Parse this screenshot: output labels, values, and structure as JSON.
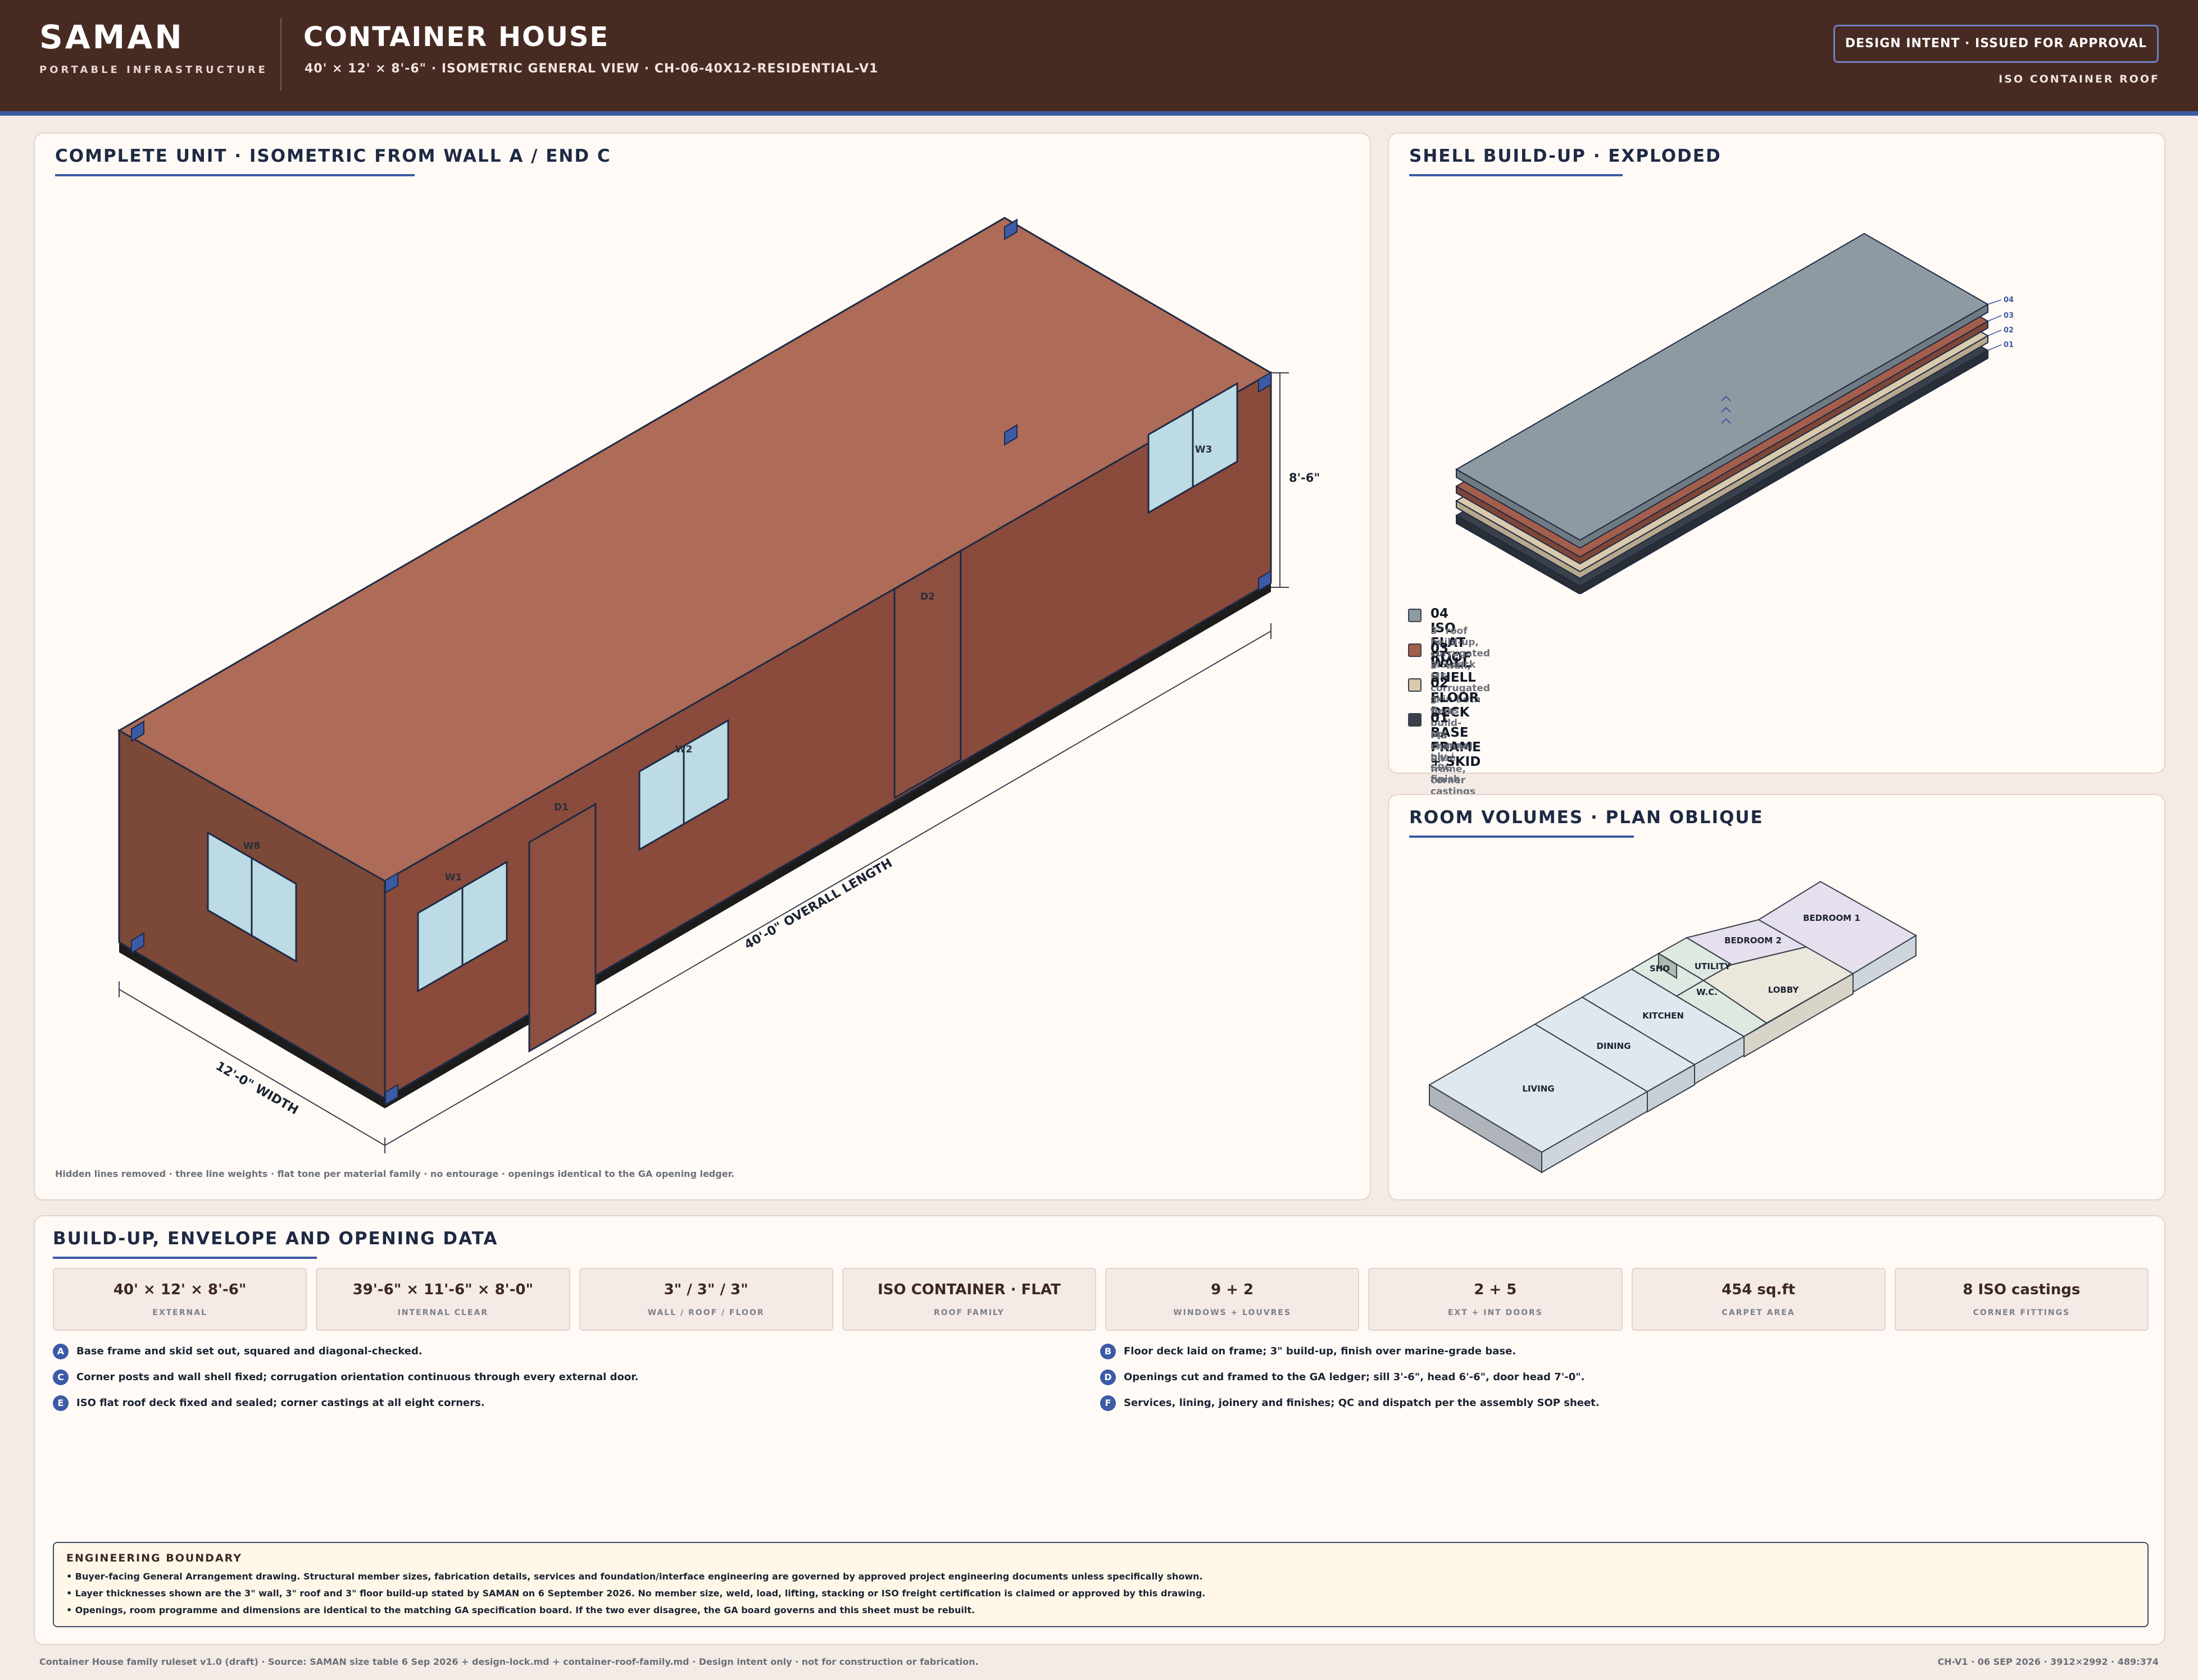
{
  "header": {
    "brand": "SAMAN",
    "brand_tag": "PORTABLE INFRASTRUCTURE",
    "title": "CONTAINER HOUSE",
    "subtitle": "40' × 12' × 8'-6\" · ISOMETRIC GENERAL VIEW · CH-06-40X12-RESIDENTIAL-V1",
    "status": "DESIGN INTENT · ISSUED FOR APPROVAL",
    "roof_family": "ISO CONTAINER ROOF"
  },
  "main": {
    "title": "COMPLETE UNIT · ISOMETRIC FROM WALL A / END C",
    "dims": {
      "length": "40'-0\" OVERALL LENGTH",
      "width": "12'-0\" WIDTH",
      "height": "8'-6\""
    },
    "openings": {
      "w1": "W1",
      "w2": "W2",
      "w3": "W3",
      "w8": "W8",
      "d1": "D1",
      "d2": "D2"
    },
    "caption": "Hidden lines removed · three line weights · flat tone per material family · no entourage · openings identical to the GA opening ledger.",
    "colors": {
      "roof": "#ad6b58",
      "wall": "#8a4b3c",
      "end_wall": "#7c4838",
      "window": "#bcdbe4",
      "casting": "#3c5aa6",
      "skid": "#1c1c1c"
    }
  },
  "shell": {
    "title": "SHELL BUILD-UP · EXPLODED",
    "tags": [
      "04",
      "03",
      "02",
      "01"
    ],
    "layers": [
      {
        "name": "04 ISO FLAT ROOF",
        "desc": "3\" roof build-up, corrugated MS deck",
        "color": "#8e9aa2"
      },
      {
        "name": "03 WALL SHELL",
        "desc": "3\" wall, MS corrugated skin both faces",
        "color": "#a45e4c"
      },
      {
        "name": "02 FLOOR DECK",
        "desc": "3\" floor build-up, marine ply / SPC finish",
        "color": "#d9c9ad"
      },
      {
        "name": "01 BASE FRAME + SKID",
        "desc": "MS channel base frame, corner castings",
        "color": "#3a4049"
      }
    ]
  },
  "rooms": {
    "title": "ROOM VOLUMES · PLAN OBLIQUE",
    "labels": {
      "living": "LIVING",
      "dining": "DINING",
      "kitchen": "KITCHEN",
      "shower": "SHO",
      "utility": "UTILITY",
      "wc": "W.C.",
      "bedroom2": "BEDROOM 2",
      "lobby": "LOBBY",
      "bedroom1": "BEDROOM 1"
    }
  },
  "data": {
    "title": "BUILD-UP, ENVELOPE AND OPENING DATA",
    "stats": [
      {
        "value": "40' × 12' × 8'-6\"",
        "label": "EXTERNAL"
      },
      {
        "value": "39'-6\" × 11'-6\" × 8'-0\"",
        "label": "INTERNAL CLEAR"
      },
      {
        "value": "3\" / 3\" / 3\"",
        "label": "WALL / ROOF / FLOOR"
      },
      {
        "value": "ISO CONTAINER · FLAT",
        "label": "ROOF FAMILY"
      },
      {
        "value": "9 + 2",
        "label": "WINDOWS + LOUVRES"
      },
      {
        "value": "2 + 5",
        "label": "EXT + INT DOORS"
      },
      {
        "value": "454 sq.ft",
        "label": "CARPET AREA"
      },
      {
        "value": "8 ISO castings",
        "label": "CORNER FITTINGS"
      }
    ],
    "steps": [
      {
        "id": "A",
        "text": "Base frame and skid set out, squared and diagonal-checked."
      },
      {
        "id": "B",
        "text": "Floor deck laid on frame; 3\" build-up, finish over marine-grade base."
      },
      {
        "id": "C",
        "text": "Corner posts and wall shell fixed; corrugation orientation continuous through every external door."
      },
      {
        "id": "D",
        "text": "Openings cut and framed to the GA ledger; sill 3'-6\", head 6'-6\", door head 7'-0\"."
      },
      {
        "id": "E",
        "text": "ISO flat roof deck fixed and sealed; corner castings at all eight corners."
      },
      {
        "id": "F",
        "text": "Services, lining, joinery and finishes; QC and dispatch per the assembly SOP sheet."
      }
    ],
    "engineering": {
      "title": "ENGINEERING BOUNDARY",
      "lines": [
        "• Buyer-facing General Arrangement drawing. Structural member sizes, fabrication details, services and foundation/interface engineering are governed by approved project engineering documents unless specifically shown.",
        "• Layer thicknesses shown are the 3\" wall, 3\" roof and 3\" floor build-up stated by SAMAN on 6 September 2026. No member size, weld, load, lifting, stacking or ISO freight certification is claimed or approved by this drawing.",
        "• Openings, room programme and dimensions are identical to the matching GA specification board. If the two ever disagree, the GA board governs and this sheet must be rebuilt."
      ]
    }
  },
  "footer": {
    "left": "Container House family ruleset v1.0 (draft) · Source: SAMAN size table 6 Sep 2026 + design-lock.md + container-roof-family.md · Design intent only · not for construction or fabrication.",
    "right": "CH-V1 · 06 SEP 2026 · 3912×2992 · 489:374"
  }
}
